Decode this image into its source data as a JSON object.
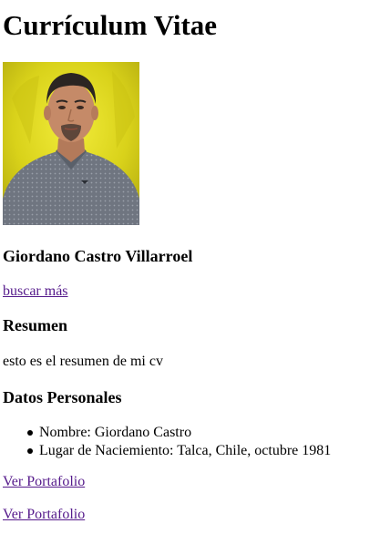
{
  "page": {
    "title": "Currículum Vitae",
    "name": "Giordano Castro Villarroel",
    "search_link": "buscar más",
    "resumen": {
      "heading": "Resumen",
      "text": "esto es el resumen de mi cv"
    },
    "datos": {
      "heading": "Datos Personales",
      "items": [
        "Nombre: Giordano Castro",
        "Lugar de Naciemiento: Talca, Chile, octubre 1981"
      ]
    },
    "portfolio_links": [
      "Ver Portafolio",
      "Ver Portafolio"
    ]
  },
  "colors": {
    "visited_link": "#551a8b",
    "photo_background": "#d9d21a"
  }
}
